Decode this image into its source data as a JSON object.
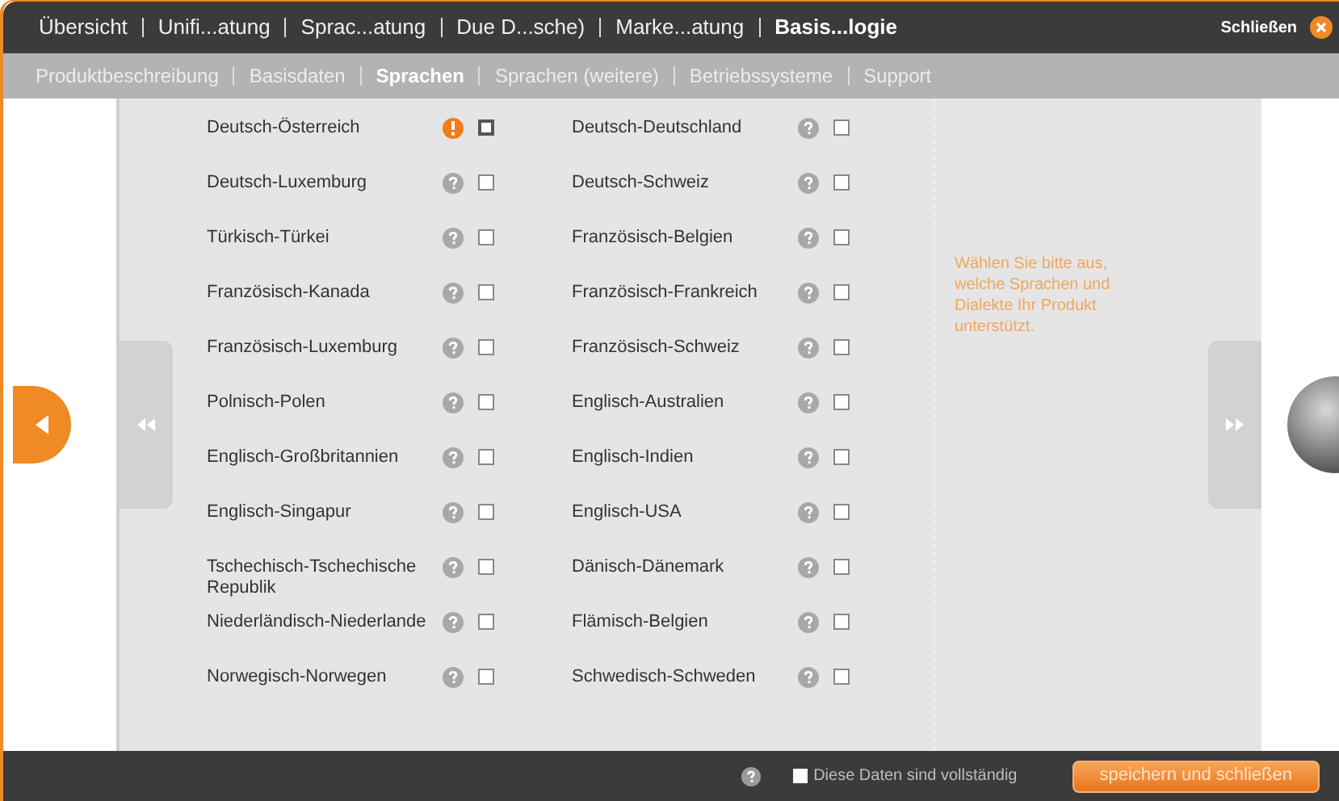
{
  "top_tabs": [
    {
      "label": "Übersicht",
      "selected": false
    },
    {
      "label": "Unifi...atung",
      "selected": false
    },
    {
      "label": "Sprac...atung",
      "selected": false
    },
    {
      "label": "Due D...sche)",
      "selected": false
    },
    {
      "label": "Marke...atung",
      "selected": false
    },
    {
      "label": "Basis...logie",
      "selected": true
    }
  ],
  "close_label": "Schließen",
  "sub_tabs": [
    {
      "label": "Produktbeschreibung",
      "selected": false
    },
    {
      "label": "Basisdaten",
      "selected": false
    },
    {
      "label": "Sprachen",
      "selected": true
    },
    {
      "label": "Sprachen (weitere)",
      "selected": false
    },
    {
      "label": "Betriebssysteme",
      "selected": false
    },
    {
      "label": "Support",
      "selected": false
    }
  ],
  "languages": [
    {
      "name": "Deutsch-Österreich",
      "kind": "alert",
      "checked": false
    },
    {
      "name": "Deutsch-Deutschland",
      "kind": "help",
      "checked": false
    },
    {
      "name": "Deutsch-Luxemburg",
      "kind": "help",
      "checked": false
    },
    {
      "name": "Deutsch-Schweiz",
      "kind": "help",
      "checked": false
    },
    {
      "name": "Türkisch-Türkei",
      "kind": "help",
      "checked": false
    },
    {
      "name": "Französisch-Belgien",
      "kind": "help",
      "checked": false
    },
    {
      "name": "Französisch-Kanada",
      "kind": "help",
      "checked": false
    },
    {
      "name": "Französisch-Frankreich",
      "kind": "help",
      "checked": false
    },
    {
      "name": "Französisch-Luxemburg",
      "kind": "help",
      "checked": false
    },
    {
      "name": "Französisch-Schweiz",
      "kind": "help",
      "checked": false
    },
    {
      "name": "Polnisch-Polen",
      "kind": "help",
      "checked": false
    },
    {
      "name": "Englisch-Australien",
      "kind": "help",
      "checked": false
    },
    {
      "name": "Englisch-Großbritannien",
      "kind": "help",
      "checked": false
    },
    {
      "name": "Englisch-Indien",
      "kind": "help",
      "checked": false
    },
    {
      "name": "Englisch-Singapur",
      "kind": "help",
      "checked": false
    },
    {
      "name": "Englisch-USA",
      "kind": "help",
      "checked": false
    },
    {
      "name": "Tschechisch-Tschechische Republik",
      "kind": "help",
      "checked": false
    },
    {
      "name": "Dänisch-Dänemark",
      "kind": "help",
      "checked": false
    },
    {
      "name": "Niederländisch-Niederlande",
      "kind": "help",
      "checked": false
    },
    {
      "name": "Flämisch-Belgien",
      "kind": "help",
      "checked": false
    },
    {
      "name": "Norwegisch-Norwegen",
      "kind": "help",
      "checked": false
    },
    {
      "name": "Schwedisch-Schweden",
      "kind": "help",
      "checked": false
    }
  ],
  "hint": "Wählen Sie bitte aus, welche Sprachen und Dialekte Ihr Produkt unterstützt.",
  "footer": {
    "complete_label": "Diese Daten sind vollständig",
    "complete_checked": false,
    "save_button": "speichern und schließen"
  }
}
